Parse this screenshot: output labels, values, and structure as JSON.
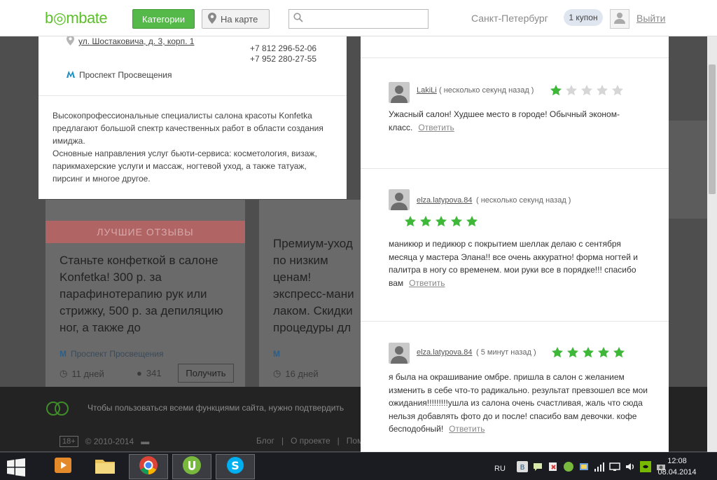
{
  "header": {
    "logo": "b◎mbate",
    "categories_label": "Категории",
    "map_label": "На карте",
    "search_placeholder": "",
    "city": "Санкт-Петербург",
    "coupon_badge": "1 купон",
    "logout_label": "Выйти"
  },
  "salon": {
    "address": "ул. Шостаковича, д. 3, корп. 1",
    "phones": [
      "+7 812 296-52-06",
      "+7 952 280-27-55"
    ],
    "metro": "Проспект Просвещения",
    "description": "Высокопрофессиональные специалисты салона красоты Konfetka предлагают большой спектр качественных работ в области создания имиджа.\nОсновные направления услуг бьюти-сервиса: косметология, визаж, парикмахерские услуги и массаж, ногтевой уход, а также татуаж, пирсинг и многое другое."
  },
  "reviews": [
    {
      "author": "LakiLi",
      "time": "( несколько секунд назад )",
      "rating": 1,
      "text": "Ужасный салон! Худшее место в городе! Обычный эконом-класс.",
      "reply_label": "Ответить"
    },
    {
      "author": "elza.latypova.84",
      "time": "( несколько секунд назад )",
      "rating": 5,
      "text": "маникюр и педикюр с покрытием шеллак делаю с сентября месяца у мастера Элана!! все очень аккуратно! форма ногтей и палитра в ногу со временем. мои руки все в порядке!!! спасибо вам",
      "reply_label": "Ответить"
    },
    {
      "author": "elza.latypova.84",
      "time": "( 5 минут назад )",
      "rating": 5,
      "text": "я была на окрашивание омбре. пришла в салон с желанием изменить в себе что-то радикально. результат превзошел все мои ожидания!!!!!!!!!ушла из салона очень счастливая, жаль что сюда нельзя добавлять фото до и после! спасибо вам девочки. кофе бесподобный!",
      "reply_label": "Ответить"
    }
  ],
  "background": {
    "ribbon": "ЛУЧШИЕ ОТЗЫВЫ",
    "card1_title": "Станьте конфеткой в салоне Konfetka! 300 р. за парафинотерапию рук или стрижку, 500 р. за депиляцию ног, а также до",
    "card2_title": "Премиум-уход по низким ценам! экспресс-мани лаком. Скидки процедуры дл топ-стилистов!",
    "card1_metro": "Проспект Просвещения",
    "card1_days": "11 дней",
    "card1_people": "341",
    "card1_get": "Получить",
    "card2_days": "16 дней",
    "banner_text": "Чтобы пользоваться всеми функциями сайта, нужно подтвердить",
    "copyright": "© 2010-2014",
    "age": "18+",
    "links": [
      "Блог",
      "О проекте",
      "Пом"
    ]
  },
  "taskbar": {
    "lang": "RU",
    "time": "12:08",
    "date": "08.04.2014"
  },
  "colors": {
    "brand_green": "#54b948",
    "star_on": "#3fb83a",
    "star_off": "#d6d6d6"
  }
}
